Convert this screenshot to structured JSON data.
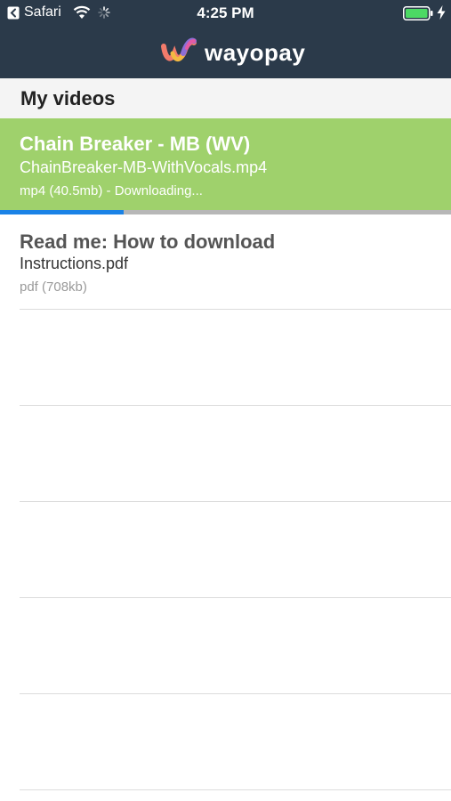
{
  "status_bar": {
    "back_app": "Safari",
    "time": "4:25 PM",
    "icons": [
      "back-chevron-icon",
      "wifi-icon",
      "activity-spinner-icon",
      "battery-icon",
      "charging-bolt-icon"
    ],
    "battery_color": "#4cd964"
  },
  "header": {
    "brand_name": "wayopay",
    "background_color": "#2b3a4a"
  },
  "section": {
    "title": "My videos"
  },
  "items": [
    {
      "title": "Chain Breaker - MB (WV)",
      "filename": "ChainBreaker-MB-WithVocals.mp4",
      "meta": "mp4 (40.5mb) - Downloading...",
      "state": "downloading",
      "progress": 0.275,
      "highlight_color": "#9fd16c",
      "progress_color": "#1a82e6"
    },
    {
      "title": "Read me: How to download",
      "filename": "Instructions.pdf",
      "meta": "pdf (708kb)",
      "state": "idle"
    }
  ]
}
